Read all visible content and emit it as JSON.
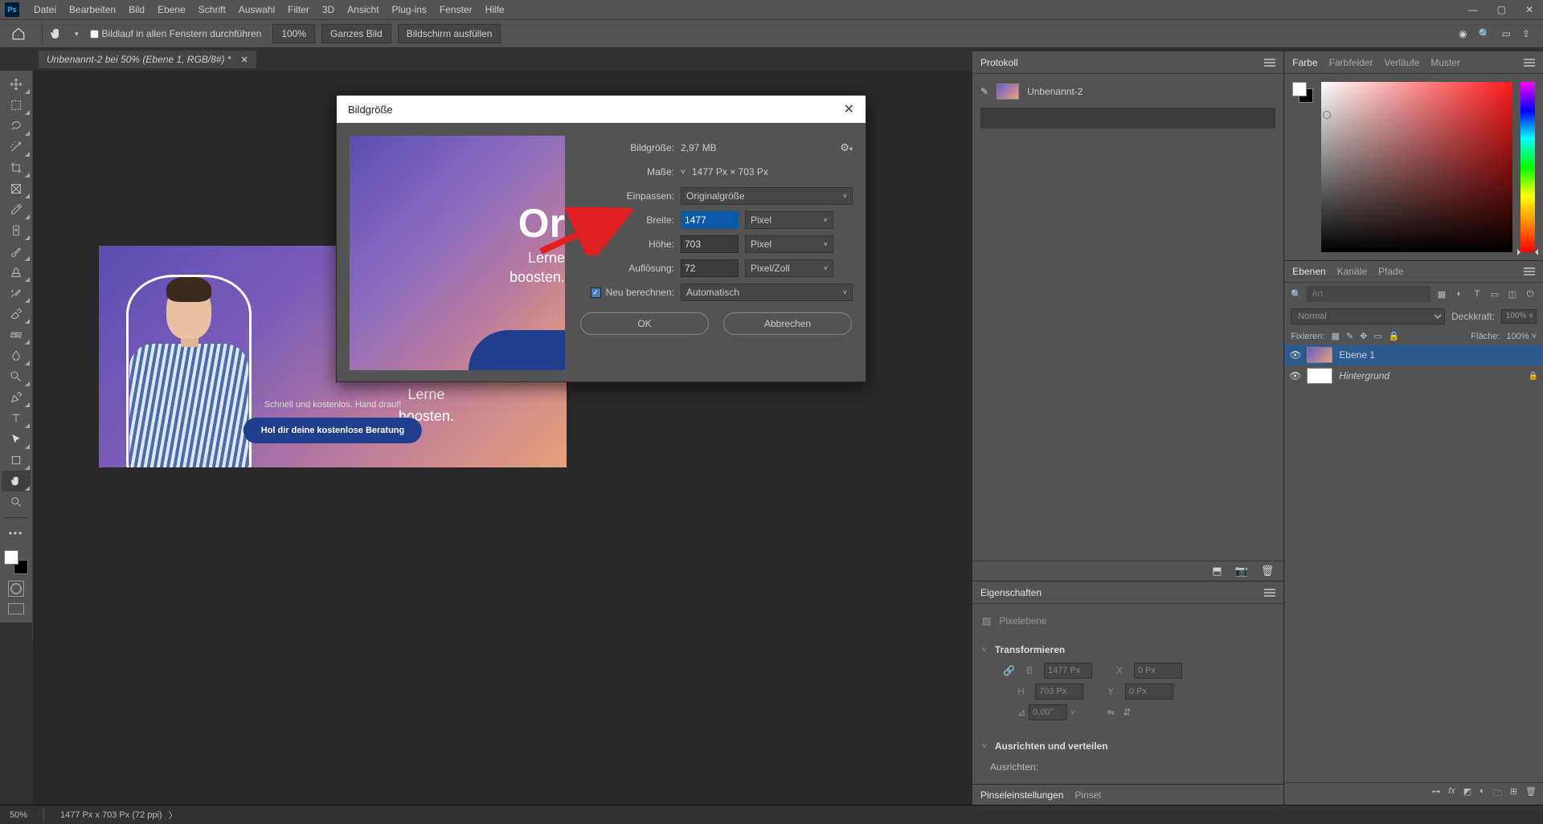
{
  "menu": [
    "Datei",
    "Bearbeiten",
    "Bild",
    "Ebene",
    "Schrift",
    "Auswahl",
    "Filter",
    "3D",
    "Ansicht",
    "Plug-ins",
    "Fenster",
    "Hilfe"
  ],
  "options": {
    "scroll_all": "Bildlauf in allen Fenstern durchführen",
    "zoom": "100%",
    "fit_image": "Ganzes Bild",
    "fit_screen": "Bildschirm ausfüllen"
  },
  "tab": {
    "title": "Unbenannt-2 bei 50% (Ebene 1, RGB/8#) *"
  },
  "document": {
    "cta_sub": "Schnell und kostenlos. Hand drauf!",
    "cta_btn": "Hol dir deine kostenlose Beratung",
    "big": "Or",
    "line_a": "Lerne",
    "line_b": "boosten."
  },
  "dialog": {
    "title": "Bildgröße",
    "size_lbl": "Bildgröße:",
    "size_val": "2,97 MB",
    "measure_lbl": "Maße:",
    "measure_val": "1477 Px  ×  703 Px",
    "fit_lbl": "Einpassen:",
    "fit_val": "Originalgröße",
    "width_lbl": "Breite:",
    "width_val": "1477",
    "height_lbl": "Höhe:",
    "height_val": "703",
    "unit_px": "Pixel",
    "res_lbl": "Auflösung:",
    "res_val": "72",
    "res_unit": "Pixel/Zoll",
    "resample_lbl": "Neu berechnen:",
    "resample_val": "Automatisch",
    "ok": "OK",
    "cancel": "Abbrechen",
    "preview_l1": "Or",
    "preview_l2": "Lerne",
    "preview_l3": "boosten."
  },
  "panels": {
    "history": {
      "tab": "Protokoll",
      "doc": "Unbenannt-2"
    },
    "properties": {
      "tab": "Eigenschaften",
      "type": "Pixelebene",
      "transform": "Transformieren",
      "w": "1477 Px",
      "h": "703 Px",
      "x": "0 Px",
      "y": "0 Px",
      "angle": "0,00°",
      "align": "Ausrichten und verteilen",
      "align_lbl": "Ausrichten:"
    },
    "brush": {
      "tab1": "Pinseleinstellungen",
      "tab2": "Pinsel"
    },
    "color": {
      "tabs": [
        "Farbe",
        "Farbfelder",
        "Verläufe",
        "Muster"
      ]
    },
    "layers": {
      "tabs": [
        "Ebenen",
        "Kanäle",
        "Pfade"
      ],
      "search_ph": "Art",
      "blend": "Normal",
      "opacity_lbl": "Deckkraft:",
      "opacity_val": "100%",
      "lock_lbl": "Fixieren:",
      "fill_lbl": "Fläche:",
      "fill_val": "100%",
      "layer1": "Ebene 1",
      "bg": "Hintergrund"
    }
  },
  "status": {
    "zoom": "50%",
    "info": "1477 Px x 703 Px (72 ppi)"
  }
}
